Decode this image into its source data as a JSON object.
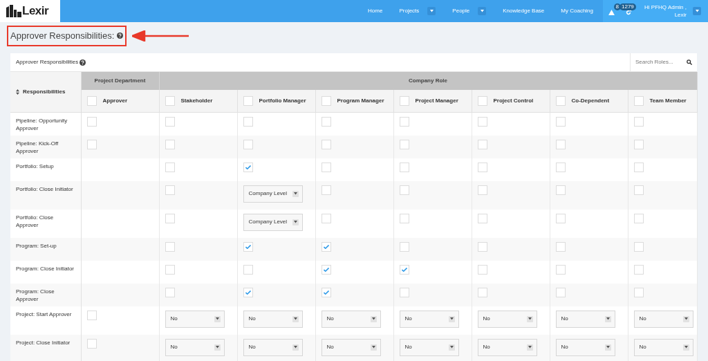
{
  "logo": {
    "text": "Lexir"
  },
  "nav": [
    {
      "label": "Home",
      "has_dropdown": false
    },
    {
      "label": "Projects",
      "has_dropdown": true
    },
    {
      "label": "People",
      "has_dropdown": true
    },
    {
      "label": "Knowledge Base",
      "has_dropdown": false
    },
    {
      "label": "My Coaching",
      "has_dropdown": false
    }
  ],
  "alerts": {
    "count": "8"
  },
  "sync": {
    "count": "1279"
  },
  "user": {
    "greeting": "Hi PFHQ Admin ,",
    "org": "Lexir"
  },
  "page_title": "Approver Responsibilities:",
  "card": {
    "title": "Approver Responsibilities",
    "search": {
      "placeholder": "Search Roles..."
    }
  },
  "table": {
    "row_header": "Responsibilities",
    "groups": [
      {
        "label": "Project Department"
      },
      {
        "label": "Company Role"
      }
    ],
    "columns": [
      {
        "label": "Approver",
        "checked": false
      },
      {
        "label": "Stakeholder",
        "checked": false
      },
      {
        "label": "Portfolio Manager",
        "checked": false
      },
      {
        "label": "Program Manager",
        "checked": false
      },
      {
        "label": "Project Manager",
        "checked": false
      },
      {
        "label": "Project Control",
        "checked": false
      },
      {
        "label": "Co-Dependent",
        "checked": false
      },
      {
        "label": "Team Member",
        "checked": false
      }
    ],
    "rows": [
      {
        "label": "Pipeline: Opportunity Approver",
        "cells": [
          {
            "kind": "checkbox",
            "checked": false
          },
          {
            "kind": "checkbox",
            "checked": false
          },
          {
            "kind": "checkbox",
            "checked": false
          },
          {
            "kind": "checkbox",
            "checked": false
          },
          {
            "kind": "checkbox",
            "checked": false
          },
          {
            "kind": "checkbox",
            "checked": false
          },
          {
            "kind": "checkbox",
            "checked": false
          },
          {
            "kind": "checkbox",
            "checked": false
          }
        ]
      },
      {
        "label": "Pipeline: Kick-Off Approver",
        "cells": [
          {
            "kind": "checkbox",
            "checked": false
          },
          {
            "kind": "checkbox",
            "checked": false
          },
          {
            "kind": "checkbox",
            "checked": false
          },
          {
            "kind": "checkbox",
            "checked": false
          },
          {
            "kind": "checkbox",
            "checked": false
          },
          {
            "kind": "checkbox",
            "checked": false
          },
          {
            "kind": "checkbox",
            "checked": false
          },
          {
            "kind": "checkbox",
            "checked": false
          }
        ]
      },
      {
        "label": "Portfolio: Setup",
        "cells": [
          {
            "kind": "empty"
          },
          {
            "kind": "checkbox",
            "checked": false
          },
          {
            "kind": "checkbox",
            "checked": true
          },
          {
            "kind": "checkbox",
            "checked": false
          },
          {
            "kind": "checkbox",
            "checked": false
          },
          {
            "kind": "checkbox",
            "checked": false
          },
          {
            "kind": "checkbox",
            "checked": false
          },
          {
            "kind": "checkbox",
            "checked": false
          }
        ]
      },
      {
        "label": "Portfolio: Close Initiator",
        "cells": [
          {
            "kind": "empty"
          },
          {
            "kind": "checkbox",
            "checked": false
          },
          {
            "kind": "select",
            "value": "Company Level"
          },
          {
            "kind": "checkbox",
            "checked": false
          },
          {
            "kind": "checkbox",
            "checked": false
          },
          {
            "kind": "checkbox",
            "checked": false
          },
          {
            "kind": "checkbox",
            "checked": false
          },
          {
            "kind": "checkbox",
            "checked": false
          }
        ]
      },
      {
        "label": "Portfolio: Close Approver",
        "cells": [
          {
            "kind": "empty"
          },
          {
            "kind": "checkbox",
            "checked": false
          },
          {
            "kind": "select",
            "value": "Company Level"
          },
          {
            "kind": "checkbox",
            "checked": false
          },
          {
            "kind": "checkbox",
            "checked": false
          },
          {
            "kind": "checkbox",
            "checked": false
          },
          {
            "kind": "checkbox",
            "checked": false
          },
          {
            "kind": "checkbox",
            "checked": false
          }
        ]
      },
      {
        "label": "Program: Set-up",
        "cells": [
          {
            "kind": "empty"
          },
          {
            "kind": "checkbox",
            "checked": false
          },
          {
            "kind": "checkbox",
            "checked": true
          },
          {
            "kind": "checkbox",
            "checked": true
          },
          {
            "kind": "checkbox",
            "checked": false
          },
          {
            "kind": "checkbox",
            "checked": false
          },
          {
            "kind": "checkbox",
            "checked": false
          },
          {
            "kind": "checkbox",
            "checked": false
          }
        ]
      },
      {
        "label": "Program: Close Initiator",
        "cells": [
          {
            "kind": "empty"
          },
          {
            "kind": "checkbox",
            "checked": false
          },
          {
            "kind": "checkbox",
            "checked": false
          },
          {
            "kind": "checkbox",
            "checked": true
          },
          {
            "kind": "checkbox",
            "checked": true
          },
          {
            "kind": "checkbox",
            "checked": false
          },
          {
            "kind": "checkbox",
            "checked": false
          },
          {
            "kind": "checkbox",
            "checked": false
          }
        ]
      },
      {
        "label": "Program: Close Approver",
        "cells": [
          {
            "kind": "empty"
          },
          {
            "kind": "checkbox",
            "checked": false
          },
          {
            "kind": "checkbox",
            "checked": true
          },
          {
            "kind": "checkbox",
            "checked": true
          },
          {
            "kind": "checkbox",
            "checked": false
          },
          {
            "kind": "checkbox",
            "checked": false
          },
          {
            "kind": "checkbox",
            "checked": false
          },
          {
            "kind": "checkbox",
            "checked": false
          }
        ]
      },
      {
        "label": "Project: Start Approver",
        "cells": [
          {
            "kind": "checkbox",
            "checked": false
          },
          {
            "kind": "select",
            "value": "No"
          },
          {
            "kind": "select",
            "value": "No"
          },
          {
            "kind": "select",
            "value": "No"
          },
          {
            "kind": "select",
            "value": "No"
          },
          {
            "kind": "select",
            "value": "No"
          },
          {
            "kind": "select",
            "value": "No"
          },
          {
            "kind": "select",
            "value": "No"
          }
        ]
      },
      {
        "label": "Project: Close Initiator",
        "cells": [
          {
            "kind": "checkbox",
            "checked": false
          },
          {
            "kind": "select",
            "value": "No"
          },
          {
            "kind": "select",
            "value": "No"
          },
          {
            "kind": "select",
            "value": "No"
          },
          {
            "kind": "select",
            "value": "No"
          },
          {
            "kind": "select",
            "value": "No"
          },
          {
            "kind": "select",
            "value": "No"
          },
          {
            "kind": "select",
            "value": "No"
          }
        ]
      }
    ]
  }
}
